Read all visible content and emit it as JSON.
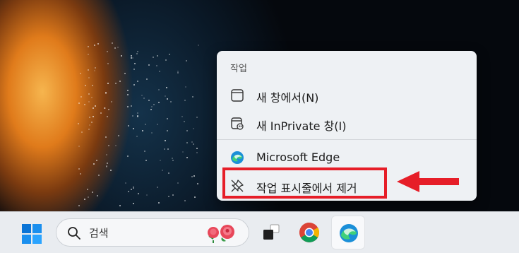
{
  "context_menu": {
    "header": "작업",
    "items": [
      {
        "label": "새 창에서(N)",
        "icon": "window-icon"
      },
      {
        "label": "새 InPrivate 창(I)",
        "icon": "inprivate-window-icon"
      },
      {
        "label": "Microsoft Edge",
        "icon": "edge-icon"
      },
      {
        "label": "작업 표시줄에서 제거",
        "icon": "unpin-icon"
      }
    ]
  },
  "annotation": {
    "highlight_color": "#e61e28",
    "arrow_color": "#e61e28"
  },
  "taskbar": {
    "start_icon": "windows-logo-icon",
    "search": {
      "placeholder": "검색",
      "icon": "search-icon",
      "decoration": "roses-icon"
    },
    "apps": [
      {
        "name": "task-view",
        "icon": "task-view-icon"
      },
      {
        "name": "chrome",
        "icon": "chrome-icon"
      },
      {
        "name": "edge",
        "icon": "edge-icon",
        "active": true
      }
    ]
  }
}
